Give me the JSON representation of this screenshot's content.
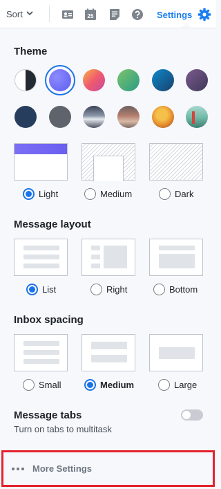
{
  "toolbar": {
    "sort_label": "Sort",
    "settings_label": "Settings",
    "icons": [
      "contact-card-icon",
      "calendar-icon",
      "notepad-icon",
      "help-icon",
      "gear-icon"
    ],
    "calendar_day": "25",
    "accent": "#1a7ef0"
  },
  "theme": {
    "title": "Theme",
    "selected_color_index": 1,
    "modes": [
      {
        "label": "Light",
        "selected": true
      },
      {
        "label": "Medium",
        "selected": false
      },
      {
        "label": "Dark",
        "selected": false
      }
    ]
  },
  "message_layout": {
    "title": "Message layout",
    "options": [
      {
        "label": "List",
        "selected": true
      },
      {
        "label": "Right",
        "selected": false
      },
      {
        "label": "Bottom",
        "selected": false
      }
    ]
  },
  "inbox_spacing": {
    "title": "Inbox spacing",
    "options": [
      {
        "label": "Small",
        "selected": false
      },
      {
        "label": "Medium",
        "selected": true
      },
      {
        "label": "Large",
        "selected": false
      }
    ]
  },
  "message_tabs": {
    "title": "Message tabs",
    "subtitle": "Turn on tabs to multitask",
    "enabled": false
  },
  "more_settings": {
    "label": "More Settings"
  }
}
